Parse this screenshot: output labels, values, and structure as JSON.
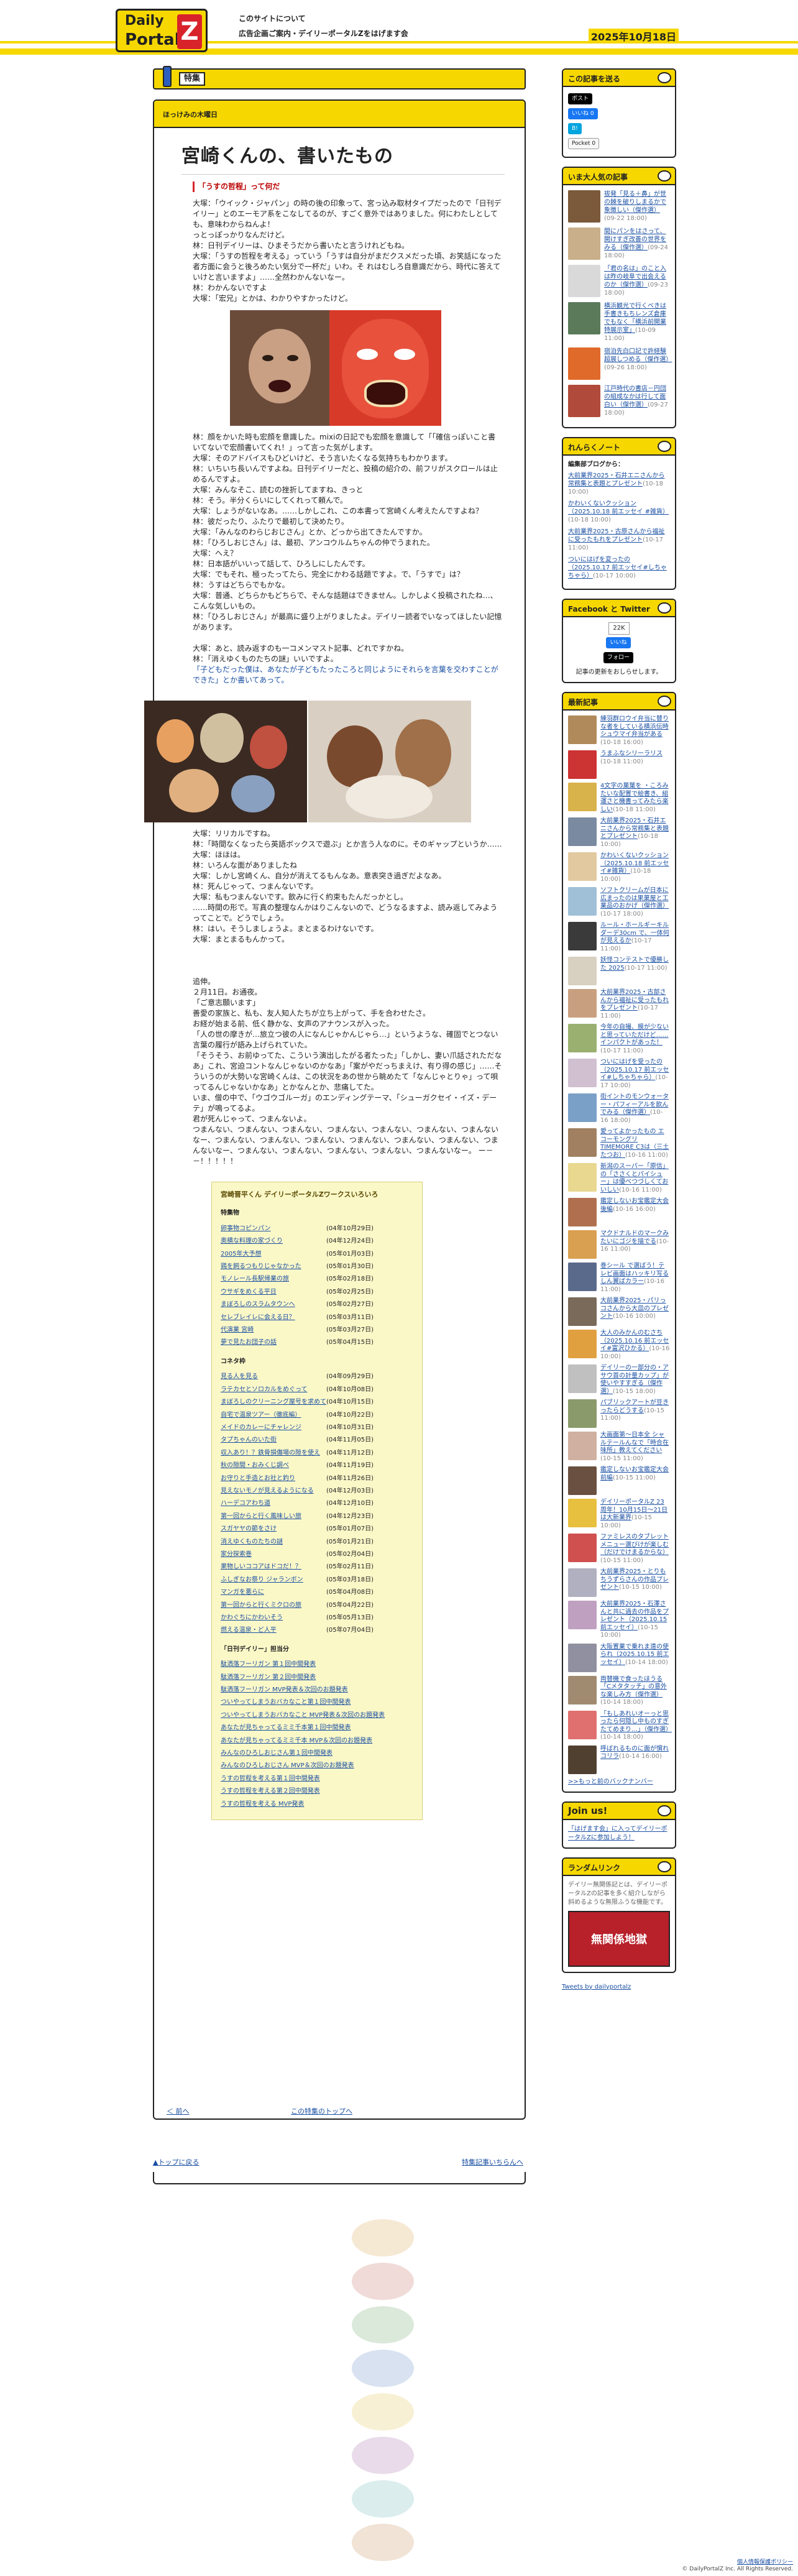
{
  "header": {
    "logo_line1": "Daily",
    "logo_line2": "Portal",
    "logo_z": "Z",
    "links": [
      "このサイトについて",
      "広告企画ご案内・デイリーポータルZをはげます会"
    ],
    "date": "2025年10月18日"
  },
  "category": {
    "label": "特集"
  },
  "article": {
    "series": "ほっけみの木曜日",
    "title": "宮崎くんの、書いたもの",
    "section1": "「うすの哲程」って何だ",
    "paras1": [
      "大塚：「ウイック・ジャパン」の時の後の印象って、宮っ込み取材タイプだったので「日刊デイリー」とのエーモア系をこなしてるのが、すごく意外ではありました。何にわたしとしても、意味わからねんよ！",
      "っとっぽっかりなんだけど。",
      "林：日刊デイリーは、ひまそうだから書いたと言うけれどもね。",
      "大塚：「うすの哲程を考える」っていう「うすは自分がまだクスメだった頃、お笑話になった者方面に会うと後ろめたい気分で一杯だ」いわ。そ れはむしろ自意識だから、時代に答えていけと言いますよ」……全然わかんないなー。",
      "林：わかんないですよ",
      "大塚：「宏兄」とかは、わかりやすかったけど。"
    ],
    "paras2": [
      "林：顔をかいた時も宏顔を意識した。mixiの日記でも宏顔を意識して「「確信っぽいこと書いてないで宏顔書いてくれ！」って言った気がします。",
      "大塚：そのアドバイスもひどいけど、そう言いたくなる気持ちもわかります。",
      "林：いちいち長いんですよね。日刊デイリーだと、投稿の紹介の、前フリがスクロールは止めるんですよ。",
      "大塚：みんなそこ、読むの挫折してますね、きっと",
      "林：そう。半分くらいにしてくれって頼んで。",
      "大塚：しょうがないなあ。……しかしこれ、この本書って宮崎くん考えたんですよね？",
      "林：彼だったり、ふたりで最初して決めたり。",
      "大塚：「みんなのわらじおじさん」とか、どっから出てきたんですか。",
      "林：「ひろしおじさん」は、最初、アンコウルムちゃんの仲でうまれた。",
      "大塚：へえ？",
      "林：日本語がいいって話して、ひろしにしたんです。",
      "大塚：でもそれ、極ったってたら、完全にかわる話題ですよ。で、「うすで」は？",
      "林：うすはどちらでもかな。",
      "大塚：普通、どちらかもどちらで、そんな話題はできません。しかしよく投稿されたね…、こんな気しいもの。",
      "林：「ひろしおじさん」が最高に盛り上がりましたよ。デイリー読者でいなってほしたい記憶があります。"
    ],
    "paras3": [
      "大塚：あと、読み返すのも一コメンマスト記事、どれですかね。",
      "林：「消えゆくものたちの謎」いいですよ。"
    ],
    "blue_line": "「子どもだった僕は、あなたが子どもたったころと同じようにそれらを言葉を交わすことができた」とか書いてあって。",
    "paras4": [
      "大塚：リリカルですね。",
      "林：「時間なくなったら英語ボックスで遊ぶ」とか言う人なのに。そのギャップというか……",
      "大塚：ほほは。",
      "林：いろんな面がありましたね",
      "大塚：しかし宮崎くん、自分が消えてるもんなあ。意表突き過ぎだよなあ。",
      "林：死んじゃって、つまんないです。",
      "大塚：私もつまんないです。飲みに行く約束もたんだっかとし。",
      "……時間の形で。写真の整理なんかはりこんないので、どうなるますよ、読み返してみようってことで。どうでしょう。",
      "林：はい。そうしましょうよ。まとまるわけないです。",
      "大塚：まとまるもんかって。"
    ],
    "paras5": [
      "追伸。",
      "２月11日。お通夜。",
      "「ご意志願います」",
      "善愛の家族と、私も、友人知人たちが立ち上がって、手を合わせたさ。",
      "お経が始まる前、低く静かな、女声のアナウンスが入った。",
      "「人の世の摩きが…旅立つ彼の人になんじゃかんじゃら…」というような、確固でとつない言葉の履行が語み上げられていた。",
      "「そうそう、お前ゆってた、こういう演出したがる者たった」「しかし、妻い爪話されただなあ」これ、宮迫コントなんじゃないのかなあ」「案がやだっちまえけ、有り得の感じ」……そういうのが大勢いな宮崎くんは、この状況をあの世から眺めたて「なんじゃとりゃ」って唄ってるんじゃないかなあ」とかなんとか、悲痛してた。",
      "いま、僧の中で、「ウゴウゴルーガ」のエンディングテーマ、「シューガクセイ・イズ・デーテ」が鳴ってるよ。",
      "君が死んじゃって、つまんないよ。",
      "つまんない、つまんない、つまんない、つまんない、つまんない、つまんない、つまんないなー、つまんない、つまんない、つまんない、つまんない、つまんない、つまんない、つまんないなー、つまんない、つまんない、つまんない、つまんない、つまんないなー。 ー－－！！！！！"
    ],
    "works_box_title": "宮崎晋平くん デイリーポータルZワークスいろいろ",
    "features_heading": "特集物",
    "features": [
      [
        "卵事物コピンパン",
        "(04年10月29日)"
      ],
      [
        "奥横な料理の家づくり",
        "(04年12月24日)"
      ],
      [
        "2005年大予想",
        "(05年01月03日)"
      ],
      [
        "鶏を飼るつもりじゃなかった",
        "(05年01月30日)"
      ],
      [
        "モノレール長駅帰業の旅",
        "(05年02月18日)"
      ],
      [
        "ウサギをめくる平日",
        "(05年02月25日)"
      ],
      [
        "まぼろしのスラムタウンへ",
        "(05年02月27日)"
      ],
      [
        "セレブレイレに会える日？",
        "(05年03月11日)"
      ],
      [
        "代演業 宮崎",
        "(05年03月27日)"
      ],
      [
        "夢で見たお団子の話",
        "(05年04月15日)"
      ]
    ],
    "columns_heading": "コネタ枠",
    "columns": [
      [
        "見る人を見る",
        "(04年09月29日)"
      ],
      [
        "ラテカセとソロカルをめぐって",
        "(04年10月08日)"
      ],
      [
        "まぼろしのクリーニング屋号を求めて",
        "(04年10月15日)"
      ],
      [
        "自宅で温泉ツアー（徹底編）",
        "(04年10月22日)"
      ],
      [
        "メイドのカレーにチャレンジ",
        "(04年10月31日)"
      ],
      [
        "タプちゃんのいた街",
        "(04年11月05日)"
      ],
      [
        "収入あり！？鉄骨損傷場の隙を使え",
        "(04年11月12日)"
      ],
      [
        "秋の隙間・おみくじ調べ",
        "(04年11月19日)"
      ],
      [
        "お守りと手造とお社と釣り",
        "(04年11月26日)"
      ],
      [
        "見えないモノが見えるようになる",
        "(04年12月03日)"
      ],
      [
        "ハーデコアわち道",
        "(04年12月10日)"
      ],
      [
        "第一回からと行く風味しい旅",
        "(04年12月23日)"
      ],
      [
        "スガヤヤの節をさけ",
        "(05年01月07日)"
      ],
      [
        "消えゆくものたちの謎",
        "(05年01月21日)"
      ],
      [
        "家分探索巻",
        "(05年02月04日)"
      ],
      [
        "果物しいココアはドコだ！？",
        "(05年02月11日)"
      ],
      [
        "ふしぎなお祭り ジャランボン",
        "(05年03月18日)"
      ],
      [
        "マンガを悪らに",
        "(05年04月08日)"
      ],
      [
        "第一回からと行くミクロの旅",
        "(05年04月22日)"
      ],
      [
        "かわぐちにかわいそう",
        "(05年05月13日)"
      ],
      [
        "燃える温泉・ど人平",
        "(05年07月04日)"
      ]
    ],
    "daily_heading": "「日刊デイリー」担当分",
    "daily": [
      "駄洒落フーリガン 第１回中間発表",
      "駄洒落フーリガン 第２回中間発表",
      "駄洒落フーリガン MVP発表＆次回のお題発表",
      "ついやってしまうおバカなこと第１回中間発表",
      "ついやってしまうおバカなこと MVP発表＆次回のお題発表",
      "あなたが見ちゃってるミミ千本第１回中間発表",
      "あなたが見ちゃってるミミ千本 MVP＆次回のお題発表",
      "みんなのひろしおじさん第１回中間発表",
      "みんなのひろしおじさん MVP＆次回のお題発表",
      "うすの哲程を考える第１回中間発表",
      "うすの哲程を考える第２回中間発表",
      "うすの哲程を考える MVP発表"
    ],
    "nav_prev": "＜ 前へ",
    "nav_top": "この特集のトップへ"
  },
  "bottom_nav": {
    "left": "▲トップに戻る",
    "right": "特集記事いちらんへ"
  },
  "sidebar": {
    "share_title": "この記事を送る",
    "share_buttons": [
      "ポスト",
      "いいね 0",
      "B!",
      "Pocket 0"
    ],
    "popular_title": "いま大人気の記事",
    "popular": [
      {
        "title": "祓発「見る＋鼻」が世の棘を破りしまるかで象徴しい（傑作選）",
        "date": "(09-22 18:00)",
        "color": "#7a5a3a"
      },
      {
        "title": "間にパンをはさって、開けすぎ改善の世界をみる（傑作選）",
        "date": "(09-24 18:00)",
        "color": "#c9b08a"
      },
      {
        "title": "「君の名は」のこと入は昨の岐阜で出会えるのか（傑作選）",
        "date": "(09-23 18:00)",
        "color": "#d9d9d9"
      },
      {
        "title": "横浜観光で行くべきは手書きもちレンズ倉庫でもなく「横浜前開業特展示室」",
        "date": "(10-09 11:00)",
        "color": "#5a7a5a"
      },
      {
        "title": "宿泊先白口記で許経験超展しつめる（傑作選）",
        "date": "(09-26 18:00)",
        "color": "#e06a2a"
      },
      {
        "title": "江戸時代の書店－円団の組成なかは行して面白い（傑作選）",
        "date": "(09-27 18:00)",
        "color": "#b04a3a"
      }
    ],
    "note_title": "れんらくノート",
    "note_heading": "編集部ブログから：",
    "notes": [
      {
        "title": "大前業界2025・石井エニさんから常務集と表題とプレゼント",
        "date": "(10-18 10:00)"
      },
      {
        "title": "かわいくないクッション（2025.10.18 前エッセイ #雑貨）",
        "date": "(10-18 10:00)"
      },
      {
        "title": "大前業界2025・古原さんから福祉に受ったもれをプレゼント",
        "date": "(10-17 11:00)"
      },
      {
        "title": "ついにはげを変ったの（2025.10.17 前エッセイ#しちゃちゃら）",
        "date": "(10-17 10:00)"
      }
    ],
    "social_title": "Facebook と Twitter",
    "social_like": "22K",
    "social_like_label": "いいね",
    "social_follow": "フォロー",
    "social_note": "記事の更新をおしらせします。",
    "latest_title": "最新記事",
    "latest": [
      {
        "title": "練羽群ロウイ弁当に替りな者をしている横浜伝時シュウマイ弁当がある",
        "date": "(10-18 16:00)",
        "color": "#b08a5a"
      },
      {
        "title": "うまふなシリーラリス",
        "date": "(10-18 11:00)",
        "color": "#c33"
      },
      {
        "title": "4文字の菓葉を ・ころみたいな配置で絵書き、組運さと機書ってみたら楽しい",
        "date": "(10-18 11:00)",
        "color": "#d8b24a"
      },
      {
        "title": "大前業界2025・石井エニさんから常務集と表題とプレゼント",
        "date": "(10-18 10:00)",
        "color": "#7a8aa0"
      },
      {
        "title": "かわいくないクッション（2025.10.18 前エッセイ#雑貨）",
        "date": "(10-18 10:00)",
        "color": "#e2c9a0"
      },
      {
        "title": "ソフトクリームが日本に広まったのは果菓屋と工業品のおかげ（傑作選）",
        "date": "(10-17 18:00)",
        "color": "#a0c0d8"
      },
      {
        "title": "ルール・ホールギーキルダーデ30cm で、一体何が見えるか",
        "date": "(10-17 11:00)",
        "color": "#3a3a3a"
      },
      {
        "title": "妖怪コンテストで優勝した 2025",
        "date": "(10-17 11:00)",
        "color": "#d8d0c0"
      },
      {
        "title": "大前業界2025・古部さんから福祉に受ったもれをプレゼント",
        "date": "(10-17 11:00)",
        "color": "#c8a080"
      },
      {
        "title": "今年の自撮、膜が少ないと思っていただけど……インパクトがあった！",
        "date": "(10-17 11:00)",
        "color": "#9ab070"
      },
      {
        "title": "ついにはげを受ったの（2025.10.17 前エッセイ#しちゃちゃら）",
        "date": "(10-17 10:00)",
        "color": "#d0c0d0"
      },
      {
        "title": "街イントのモンウォーター・パフィーアルを飲んでみる（傑作選）",
        "date": "(10-16 18:00)",
        "color": "#7aa0c8"
      },
      {
        "title": "愛ってよかったもの エコーモングリ TIMEMORE C3は（三土たつお）",
        "date": "(10-16 11:00)",
        "color": "#a08060"
      },
      {
        "title": "新潟のスーパー「原信」の「ささくとパイシュー」は優べつづしくておいしい",
        "date": "(10-16 11:00)",
        "color": "#e8d890"
      },
      {
        "title": "鑑定しないお宝鑑定大会 後編",
        "date": "(10-16 16:00)",
        "color": "#b07050"
      },
      {
        "title": "マクドナルドのマークみたいにゴジを描でる",
        "date": "(10-16 11:00)",
        "color": "#d8a050"
      },
      {
        "title": "巻シール で選ばう！テレビ画面はハッキリ写るしん翼ばカラー",
        "date": "(10-16 11:00)",
        "color": "#5a6a8a"
      },
      {
        "title": "大前業界2025・パリっコさんから大皿のプレゼント",
        "date": "(10-16 10:00)",
        "color": "#7a6a5a"
      },
      {
        "title": "大人のみかんのむさち（2025.10.16 前エッセイ#富沢ひかる）",
        "date": "(10-16 10:00)",
        "color": "#e0a040"
      },
      {
        "title": "デイリーの一部分の・アサウ首の計量カップ」が使いやすすぎる（傑作選）",
        "date": "(10-15 18:00)",
        "color": "#c0c0c0"
      },
      {
        "title": "パブリックアートが豆きったらどうする",
        "date": "(10-15 11:00)",
        "color": "#8a9a6a"
      },
      {
        "title": "大画面第〜日本全 シャルテールんなで「時合在味所」教えてください",
        "date": "(10-15 11:00)",
        "color": "#d0b0a0"
      },
      {
        "title": "鑑定しないお宝鑑定大会 前編",
        "date": "(10-15 11:00)",
        "color": "#6a5040"
      },
      {
        "title": "デイリーポータルZ 23周年！10月15日〜21日は大新業界",
        "date": "(10-15 10:00)",
        "color": "#e8c040"
      },
      {
        "title": "ファミレスのタブレットメニュー選びけが楽しむ（だけでけまるからな）",
        "date": "(10-15 11:00)",
        "color": "#d05050"
      },
      {
        "title": "大前業界2025・とりもちうずらさんの作品プレゼント",
        "date": "(10-15 10:00)",
        "color": "#b0b0c0"
      },
      {
        "title": "大前業界2025・石澤さんと共に過去の作品をプレゼント（2025.10.15 前エッセイ）",
        "date": "(10-15 10:00)",
        "color": "#c0a0c0"
      },
      {
        "title": "大阪置業で乗れま遠の使られ（2025.10.15 前エッセイ）",
        "date": "(10-14 18:00)",
        "color": "#9090a0"
      },
      {
        "title": "両替機で食ったほうる「Cメタタッチ」の意外な楽しみ方（傑作選）",
        "date": "(10-14 18:00)",
        "color": "#a08a70"
      },
      {
        "title": "「もしあれいオーっと思ったら何隠し中ものすぎたてめまり…」（傑作選）",
        "date": "(10-14 18:00)",
        "color": "#e07070"
      },
      {
        "title": "呼ばれるものに面が慣れコリラ",
        "date": "(10-14 16:00)",
        "color": "#504030"
      }
    ],
    "latest_more": ">>もっと前のバックナンバー",
    "join_title": "Join us!",
    "join_text": "「はげます会」に入ってデイリーポータルZに参加しよう！",
    "random_title": "ランダムリンク",
    "random_text": "デイリー無関係記とは、デイリーポータルZの記事を多く紹介しながら斜めるような無限ふうな機能です。",
    "random_img_label": "無関係地獄",
    "tweets": "Tweets by dailyportalz"
  },
  "footer": {
    "links": "個人情報保護ポリシー",
    "copyright": "© DailyPortalZ Inc. All Rights Reserved."
  }
}
